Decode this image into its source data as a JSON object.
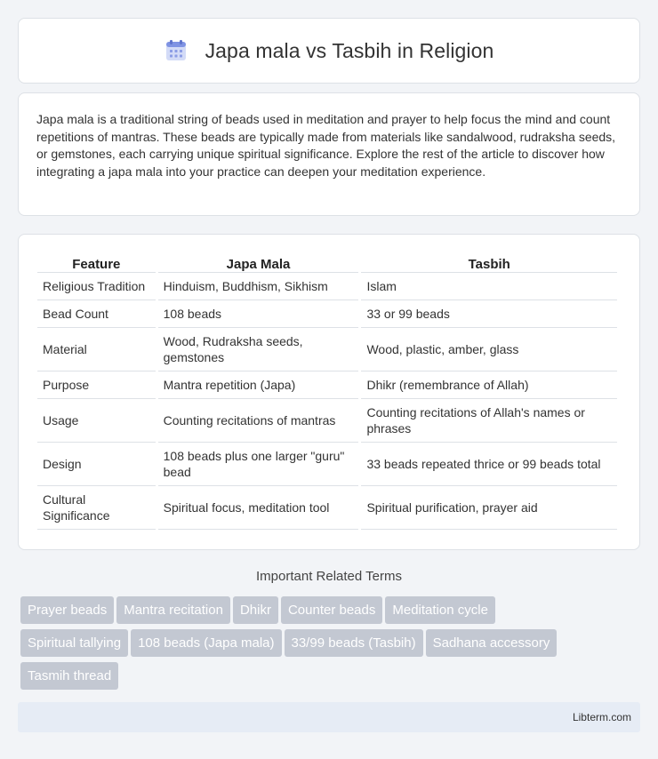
{
  "header": {
    "title": "Japa mala vs Tasbih in Religion",
    "icon": "calendar-grid-icon"
  },
  "intro": {
    "text": "Japa mala is a traditional string of beads used in meditation and prayer to help focus the mind and count repetitions of mantras. These beads are typically made from materials like sandalwood, rudraksha seeds, or gemstones, each carrying unique spiritual significance. Explore the rest of the article to discover how integrating a japa mala into your practice can deepen your meditation experience."
  },
  "table": {
    "headers": [
      "Feature",
      "Japa Mala",
      "Tasbih"
    ],
    "rows": [
      [
        "Religious Tradition",
        "Hinduism, Buddhism, Sikhism",
        "Islam"
      ],
      [
        "Bead Count",
        "108 beads",
        "33 or 99 beads"
      ],
      [
        "Material",
        "Wood, Rudraksha seeds, gemstones",
        "Wood, plastic, amber, glass"
      ],
      [
        "Purpose",
        "Mantra repetition (Japa)",
        "Dhikr (remembrance of Allah)"
      ],
      [
        "Usage",
        "Counting recitations of mantras",
        "Counting recitations of Allah's names or phrases"
      ],
      [
        "Design",
        "108 beads plus one larger \"guru\" bead",
        "33 beads repeated thrice or 99 beads total"
      ],
      [
        "Cultural Significance",
        "Spiritual focus, meditation tool",
        "Spiritual purification, prayer aid"
      ]
    ]
  },
  "related": {
    "title": "Important Related Terms",
    "terms": [
      "Prayer beads",
      "Mantra recitation",
      "Dhikr",
      "Counter beads",
      "Meditation cycle",
      "Spiritual tallying",
      "108 beads (Japa mala)",
      "33/99 beads (Tasbih)",
      "Sadhana accessory",
      "Tasmih thread"
    ]
  },
  "footer": {
    "brand": "Libterm.com"
  },
  "colors": {
    "tag_bg": "#c3c8d2",
    "footer_bg": "#e6ecf5",
    "icon_top": "#7b8fe0",
    "icon_body": "#c9d3f5"
  }
}
